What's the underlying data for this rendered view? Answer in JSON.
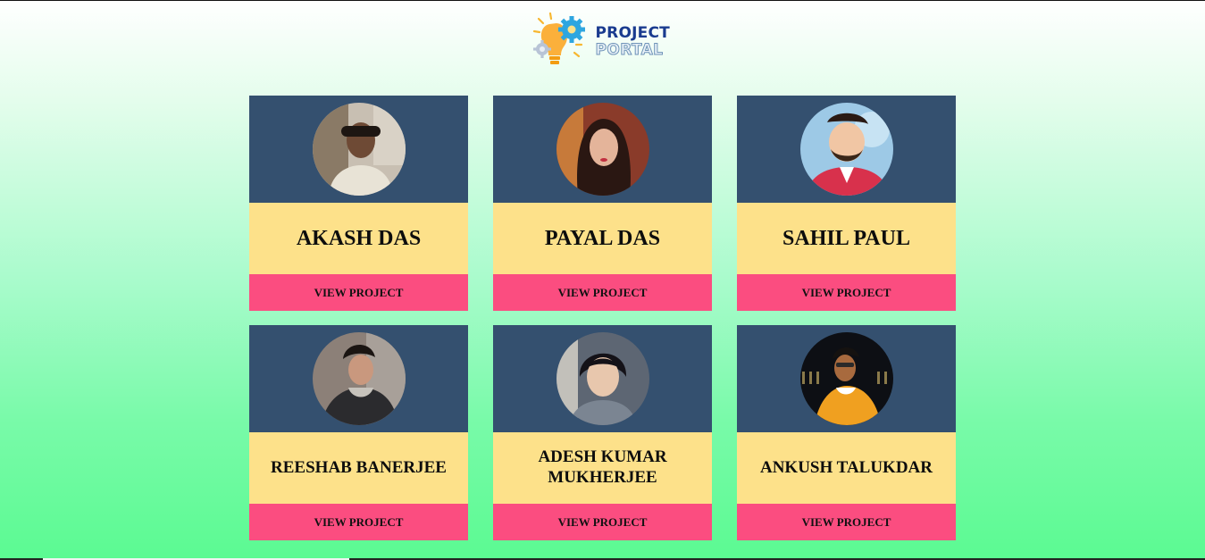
{
  "brand": {
    "line1": "PROJECT",
    "line2": "PORTAL",
    "icon": "lightbulb-gear-icon"
  },
  "cards": [
    {
      "name": "AKASH DAS",
      "button": "VIEW PROJECT",
      "avatar": "avatar-photo"
    },
    {
      "name": "PAYAL DAS",
      "button": "VIEW PROJECT",
      "avatar": "avatar-photo"
    },
    {
      "name": "SAHIL PAUL",
      "button": "VIEW PROJECT",
      "avatar": "avatar-illustration"
    },
    {
      "name": "REESHAB BANERJEE",
      "button": "VIEW PROJECT",
      "avatar": "avatar-photo"
    },
    {
      "name": "ADESH KUMAR MUKHERJEE",
      "button": "VIEW PROJECT",
      "avatar": "avatar-photo"
    },
    {
      "name": "ANKUSH TALUKDAR",
      "button": "VIEW PROJECT",
      "avatar": "avatar-photo"
    }
  ],
  "colors": {
    "card_top": "#34506f",
    "card_name_bg": "#fde18a",
    "button_bg": "#fb4d80",
    "page_gradient_bottom": "#5bfa92"
  }
}
